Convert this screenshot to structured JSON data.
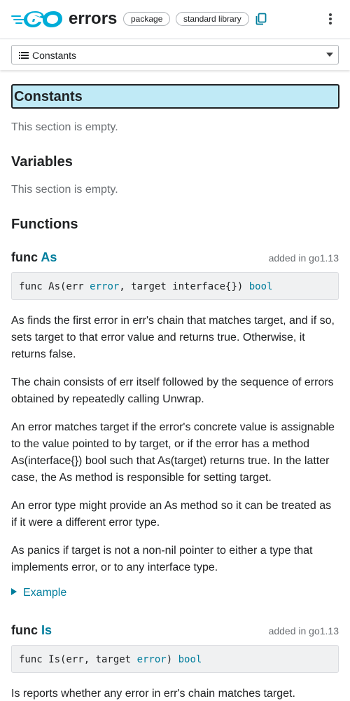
{
  "header": {
    "logo_icon": "go-logo-icon",
    "package_name": "errors",
    "chips": [
      "package",
      "standard library"
    ],
    "copy_icon": "copy-icon",
    "menu_icon": "more-vert-icon"
  },
  "jump": {
    "icon": "list-icon",
    "selected": "Constants"
  },
  "sections": {
    "constants": {
      "title": "Constants",
      "empty": "This section is empty."
    },
    "variables": {
      "title": "Variables",
      "empty": "This section is empty."
    },
    "functions": {
      "title": "Functions"
    }
  },
  "functions": [
    {
      "keyword": "func",
      "name": "As",
      "added": "added in go1.13",
      "signature": {
        "prefix": "func As(err ",
        "type1": "error",
        "middle": ", target interface{}) ",
        "type2": "bool"
      },
      "paragraphs": [
        "As finds the first error in err's chain that matches target, and if so, sets target to that error value and returns true. Otherwise, it returns false.",
        "The chain consists of err itself followed by the sequence of errors obtained by repeatedly calling Unwrap.",
        "An error matches target if the error's concrete value is assignable to the value pointed to by target, or if the error has a method As(interface{}) bool such that As(target) returns true. In the latter case, the As method is responsible for setting target.",
        "An error type might provide an As method so it can be treated as if it were a different error type.",
        "As panics if target is not a non-nil pointer to either a type that implements error, or to any interface type."
      ],
      "example_label": "Example"
    },
    {
      "keyword": "func",
      "name": "Is",
      "added": "added in go1.13",
      "signature": {
        "prefix": "func Is(err, target ",
        "type1": "error",
        "middle": ") ",
        "type2": "bool"
      },
      "paragraphs": [
        "Is reports whether any error in err's chain matches target."
      ]
    }
  ],
  "colors": {
    "link": "#007d9c",
    "highlight": "#c0eaf6",
    "code_bg": "#f0f1f2"
  }
}
